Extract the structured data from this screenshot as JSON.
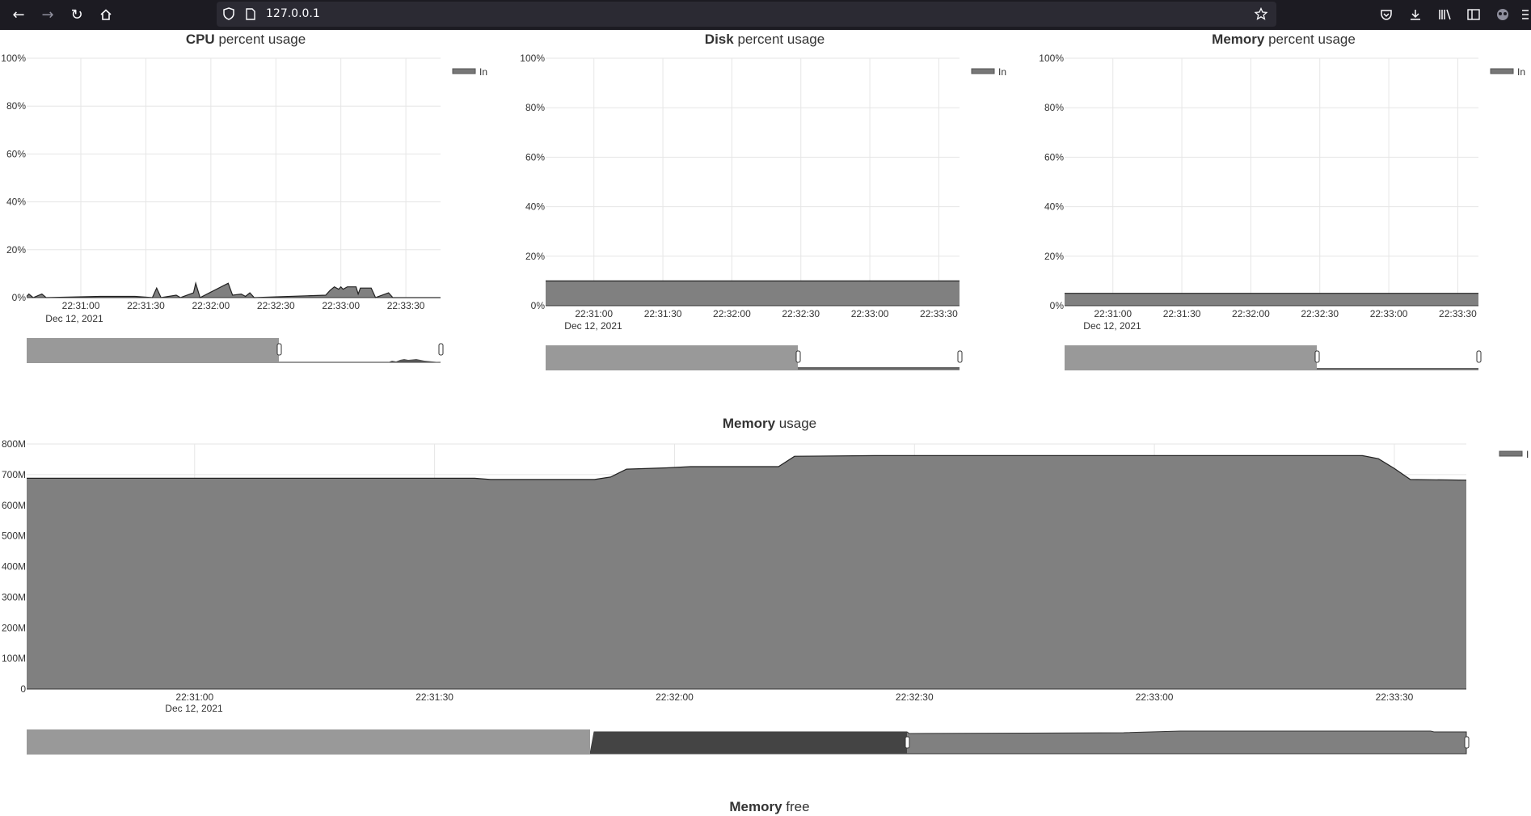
{
  "browser": {
    "url": "127.0.0.1",
    "colors": {
      "toolbar": "#1c1b22",
      "urlbar": "#2b2a33",
      "icon": "#fbfbfe"
    }
  },
  "theme": {
    "fill": "#808080",
    "navigator_mask": "#999999",
    "navigator_window": "#555555",
    "grid": "#e6e6e6"
  },
  "charts": [
    {
      "title_bold": "CPU",
      "title_rest": " percent usage",
      "legend": "In",
      "date_label": "Dec 12, 2021",
      "y_ticks": [
        "100%",
        "80%",
        "60%",
        "40%",
        "20%",
        "0%"
      ],
      "x_ticks": [
        "22:31:00",
        "22:31:30",
        "22:32:00",
        "22:32:30",
        "22:33:00",
        "22:33:30"
      ]
    },
    {
      "title_bold": "Disk",
      "title_rest": " percent usage",
      "legend": "In",
      "date_label": "Dec 12, 2021",
      "y_ticks": [
        "100%",
        "80%",
        "60%",
        "40%",
        "20%",
        "0%"
      ],
      "x_ticks": [
        "22:31:00",
        "22:31:30",
        "22:32:00",
        "22:32:30",
        "22:33:00",
        "22:33:30"
      ]
    },
    {
      "title_bold": "Memory",
      "title_rest": " percent usage",
      "legend": "In",
      "date_label": "Dec 12, 2021",
      "y_ticks": [
        "100%",
        "80%",
        "60%",
        "40%",
        "20%",
        "0%"
      ],
      "x_ticks": [
        "22:31:00",
        "22:31:30",
        "22:32:00",
        "22:32:30",
        "22:33:00",
        "22:33:30"
      ]
    },
    {
      "title_bold": "Memory",
      "title_rest": " usage",
      "legend": "I",
      "date_label": "Dec 12, 2021",
      "y_ticks": [
        "800M",
        "700M",
        "600M",
        "500M",
        "400M",
        "300M",
        "200M",
        "100M",
        "0"
      ],
      "x_ticks": [
        "22:31:00",
        "22:31:30",
        "22:32:00",
        "22:32:30",
        "22:33:00",
        "22:33:30"
      ]
    },
    {
      "title_bold": "Memory",
      "title_rest": " free"
    }
  ],
  "chart_data": [
    {
      "type": "area",
      "title": "CPU percent usage",
      "x_range": [
        "22:30:35",
        "22:33:46"
      ],
      "ylim": [
        0,
        100
      ],
      "y_unit": "%",
      "grid": true,
      "legend_position": "top-right",
      "series": [
        {
          "name": "In",
          "points": [
            [
              "22:30:35",
              0.5
            ],
            [
              "22:30:36",
              1.5
            ],
            [
              "22:30:38",
              0
            ],
            [
              "22:30:42",
              1.5
            ],
            [
              "22:30:44",
              0
            ],
            [
              "22:31:09",
              0.5
            ],
            [
              "22:31:25",
              0.5
            ],
            [
              "22:31:33",
              0
            ],
            [
              "22:31:35",
              4
            ],
            [
              "22:31:37",
              0
            ],
            [
              "22:31:44",
              1
            ],
            [
              "22:31:46",
              0
            ],
            [
              "22:31:52",
              2
            ],
            [
              "22:31:53",
              6
            ],
            [
              "22:31:55",
              0
            ],
            [
              "22:32:08",
              6
            ],
            [
              "22:32:10",
              1
            ],
            [
              "22:32:14",
              1.5
            ],
            [
              "22:32:16",
              0.5
            ],
            [
              "22:32:18",
              2
            ],
            [
              "22:32:20",
              0
            ],
            [
              "22:32:53",
              1
            ],
            [
              "22:32:55",
              3
            ],
            [
              "22:32:57",
              4.5
            ],
            [
              "22:32:59",
              3.5
            ],
            [
              "22:33:00",
              4.5
            ],
            [
              "22:33:01",
              3.5
            ],
            [
              "22:33:03",
              4.5
            ],
            [
              "22:33:07",
              4.5
            ],
            [
              "22:33:08",
              1.5
            ],
            [
              "22:33:09",
              4
            ],
            [
              "22:33:14",
              4
            ],
            [
              "22:33:16",
              0
            ],
            [
              "22:33:22",
              2
            ],
            [
              "22:33:24",
              0
            ],
            [
              "22:33:46",
              0
            ]
          ]
        }
      ]
    },
    {
      "type": "area",
      "title": "Disk percent usage",
      "x_range": [
        "22:30:39",
        "22:33:39"
      ],
      "ylim": [
        0,
        100
      ],
      "y_unit": "%",
      "grid": true,
      "legend_position": "top-right",
      "series": [
        {
          "name": "In",
          "points": [
            [
              "22:30:39",
              10
            ],
            [
              "22:33:39",
              10
            ]
          ]
        }
      ]
    },
    {
      "type": "area",
      "title": "Memory percent usage",
      "x_range": [
        "22:30:39",
        "22:33:39"
      ],
      "ylim": [
        0,
        100
      ],
      "y_unit": "%",
      "grid": true,
      "legend_position": "top-right",
      "series": [
        {
          "name": "In",
          "points": [
            [
              "22:30:39",
              5
            ],
            [
              "22:33:39",
              5
            ]
          ]
        }
      ]
    },
    {
      "type": "area",
      "title": "Memory usage",
      "x_range": [
        "22:30:39",
        "22:33:39"
      ],
      "ylim": [
        0,
        800
      ],
      "y_unit": "M",
      "grid": true,
      "legend_position": "top-right",
      "series": [
        {
          "name": "I",
          "points": [
            [
              "22:30:39",
              688
            ],
            [
              "22:31:35",
              688
            ],
            [
              "22:31:37",
              684
            ],
            [
              "22:31:50",
              684
            ],
            [
              "22:31:52",
              692
            ],
            [
              "22:31:54",
              718
            ],
            [
              "22:31:59",
              722
            ],
            [
              "22:32:02",
              726
            ],
            [
              "22:32:13",
              726
            ],
            [
              "22:32:15",
              760
            ],
            [
              "22:32:25",
              762
            ],
            [
              "22:33:26",
              762
            ],
            [
              "22:33:28",
              752
            ],
            [
              "22:33:30",
              720
            ],
            [
              "22:33:32",
              684
            ],
            [
              "22:33:39",
              682
            ]
          ]
        }
      ]
    }
  ]
}
